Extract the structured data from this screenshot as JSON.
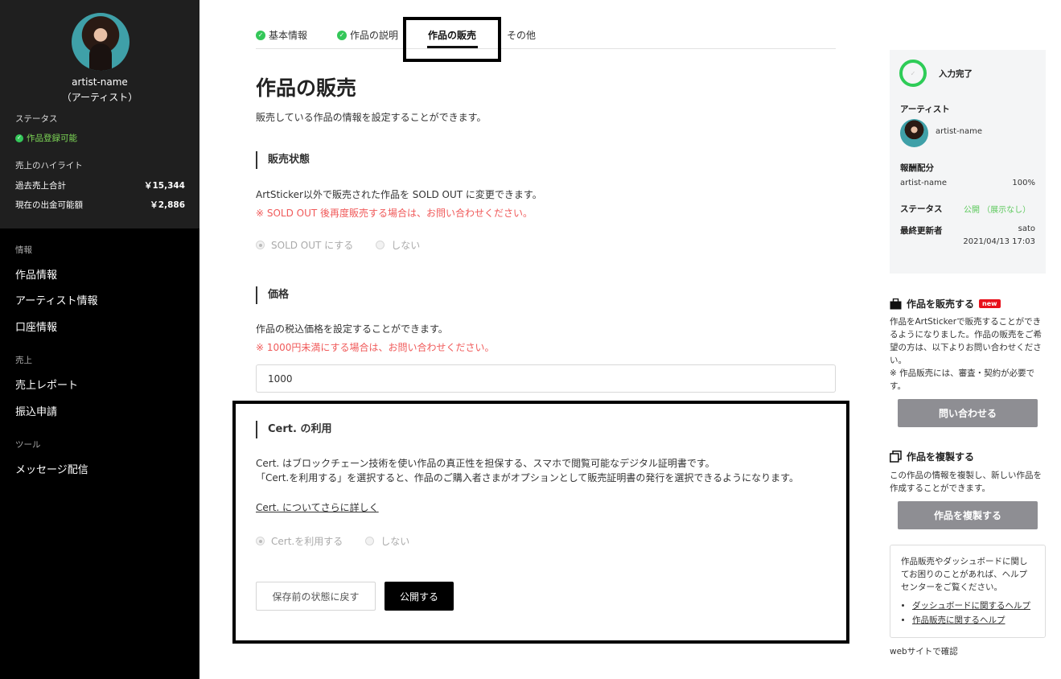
{
  "sidebar": {
    "artist_name": "artist-name",
    "role": "（アーティスト）",
    "status_label": "ステータス",
    "status_value": "作品登録可能",
    "highlight_label": "売上のハイライト",
    "rows": [
      {
        "label": "過去売上合計",
        "value": "￥15,344"
      },
      {
        "label": "現在の出金可能額",
        "value": "￥2,886"
      }
    ],
    "sections": [
      {
        "title": "情報",
        "items": [
          "作品情報",
          "アーティスト情報",
          "口座情報"
        ]
      },
      {
        "title": "売上",
        "items": [
          "売上レポート",
          "振込申請"
        ]
      },
      {
        "title": "ツール",
        "items": [
          "メッセージ配信"
        ]
      }
    ]
  },
  "tabs": [
    {
      "label": "基本情報",
      "done": true
    },
    {
      "label": "作品の説明",
      "done": true
    },
    {
      "label": "作品の販売",
      "active": true
    },
    {
      "label": "その他"
    }
  ],
  "main": {
    "title": "作品の販売",
    "description": "販売している作品の情報を設定することができます。",
    "sale_status": {
      "heading": "販売状態",
      "text": "ArtSticker以外で販売された作品を SOLD OUT に変更できます。",
      "warning": "※ SOLD OUT 後再度販売する場合は、お問い合わせください。",
      "options": [
        "SOLD OUT にする",
        "しない"
      ]
    },
    "price": {
      "heading": "価格",
      "text": "作品の税込価格を設定することができます。",
      "warning": "※ 1000円未満にする場合は、お問い合わせください。",
      "value": "1000"
    },
    "cert": {
      "heading": "Cert. の利用",
      "text1": "Cert. はブロックチェーン技術を使い作品の真正性を担保する、スマホで閲覧可能なデジタル証明書です。",
      "text2": "「Cert.を利用する」を選択すると、作品のご購入者さまがオプションとして販売証明書の発行を選択できるようになります。",
      "link": "Cert. についてさらに詳しく",
      "options": [
        "Cert.を利用する",
        "しない"
      ]
    },
    "buttons": {
      "revert": "保存前の状態に戻す",
      "publish": "公開する"
    }
  },
  "right": {
    "progress_label": "入力完了",
    "artist_label": "アーティスト",
    "artist_name": "artist-name",
    "share_label": "報酬配分",
    "share_name": "artist-name",
    "share_pct": "100%",
    "status_label": "ステータス",
    "status_value": "公開 （展示なし）",
    "updated_label": "最終更新者",
    "updated_by": "sato",
    "updated_at": "2021/04/13 17:03",
    "sell": {
      "heading": "作品を販売する",
      "badge": "new",
      "text": "作品をArtStickerで販売することができるようになりました。作品の販売をご希望の方は、以下よりお問い合わせください。",
      "note": "※ 作品販売には、審査・契約が必要です。",
      "button": "問い合わせる"
    },
    "copy": {
      "heading": "作品を複製する",
      "text": "この作品の情報を複製し、新しい作品を作成することができます。",
      "button": "作品を複製する"
    },
    "help": {
      "text": "作品販売やダッシュボードに関してお困りのことがあれば、ヘルプセンターをご覧ください。",
      "links": [
        "ダッシュボードに関するヘルプ",
        "作品販売に関するヘルプ"
      ]
    },
    "web_confirm": "webサイトで確認"
  },
  "colors": {
    "accent_green": "#34c759",
    "warning_red": "#f05a5a",
    "badge_red": "#e8101a",
    "button_grey": "#8e8e93"
  }
}
